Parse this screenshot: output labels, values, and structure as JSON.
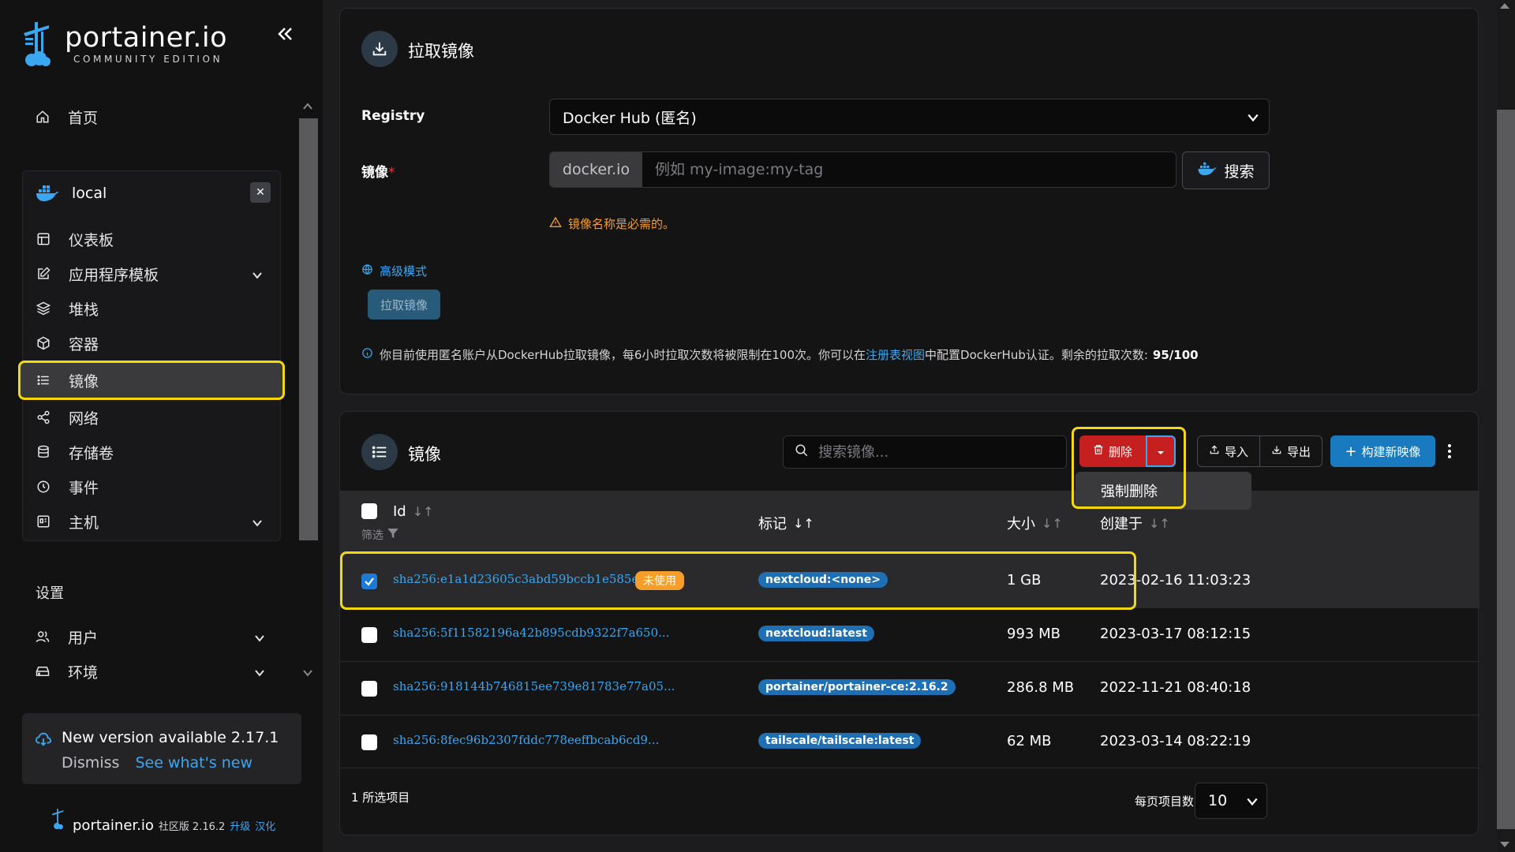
{
  "app": {
    "logo_title": "portainer.io",
    "logo_subtitle": "COMMUNITY EDITION"
  },
  "sidebar": {
    "home_label": "首页",
    "environment": {
      "name": "local",
      "items": [
        {
          "label": "仪表板"
        },
        {
          "label": "应用程序模板"
        },
        {
          "label": "堆栈"
        },
        {
          "label": "容器"
        },
        {
          "label": "镜像"
        },
        {
          "label": "网络"
        },
        {
          "label": "存储卷"
        },
        {
          "label": "事件"
        },
        {
          "label": "主机"
        }
      ]
    },
    "settings_title": "设置",
    "settings_items": [
      {
        "label": "用户"
      },
      {
        "label": "环境"
      }
    ],
    "update": {
      "title": "New version available 2.17.1",
      "dismiss": "Dismiss",
      "whats_new": "See what's new"
    },
    "footer": {
      "name": "portainer.io",
      "edition": "社区版",
      "version": "2.16.2",
      "upgrade": "升级",
      "localize": "汉化"
    }
  },
  "pull_card": {
    "title": "拉取镜像",
    "registry_label": "Registry",
    "registry_value": "Docker Hub (匿名)",
    "image_label": "镜像",
    "image_required": "*",
    "image_prefix": "docker.io",
    "image_placeholder": "例如 my-image:my-tag",
    "search_label": "搜索",
    "warning": "镜像名称是必需的。",
    "advanced_label": "高级模式",
    "pull_button": "拉取镜像",
    "info_prefix": "你目前使用匿名账户从DockerHub拉取镜像，每6小时拉取次数将被限制在100次。你可以在",
    "info_link": "注册表视图",
    "info_suffix": "中配置DockerHub认证。剩余的拉取次数:",
    "info_count": "95/100"
  },
  "images_card": {
    "title": "镜像",
    "search_placeholder": "搜索镜像...",
    "delete_label": "删除",
    "force_delete_label": "强制删除",
    "import_label": "导入",
    "export_label": "导出",
    "build_label": "构建新映像",
    "columns": {
      "id": "Id",
      "filter": "筛选",
      "tags": "标记",
      "size": "大小",
      "created": "创建于"
    },
    "rows": [
      {
        "id": "sha256:e1a1d23605c3abd59bccb1e585e763...",
        "unused": "未使用",
        "tag": "nextcloud:<none>",
        "size": "1 GB",
        "created": "2023-02-16 11:03:23",
        "selected": true
      },
      {
        "id": "sha256:5f11582196a42b895cdb9322f7a650...",
        "unused": "",
        "tag": "nextcloud:latest",
        "size": "993 MB",
        "created": "2023-03-17 08:12:15",
        "selected": false
      },
      {
        "id": "sha256:918144b746815ee739e81783e77a05...",
        "unused": "",
        "tag": "portainer/portainer-ce:2.16.2",
        "size": "286.8 MB",
        "created": "2022-11-21 08:40:18",
        "selected": false
      },
      {
        "id": "sha256:8fec96b2307fddc778eeffbcab6cd9...",
        "unused": "",
        "tag": "tailscale/tailscale:latest",
        "size": "62 MB",
        "created": "2023-03-14 08:22:19",
        "selected": false
      }
    ],
    "selected_count": "1 所选项目",
    "per_page_label": "每页项目数",
    "per_page_value": "10"
  },
  "colors": {
    "accent": "#3ba7f0",
    "highlight": "#f5d90a",
    "danger": "#c51f1f",
    "warning": "#f59e2a"
  }
}
